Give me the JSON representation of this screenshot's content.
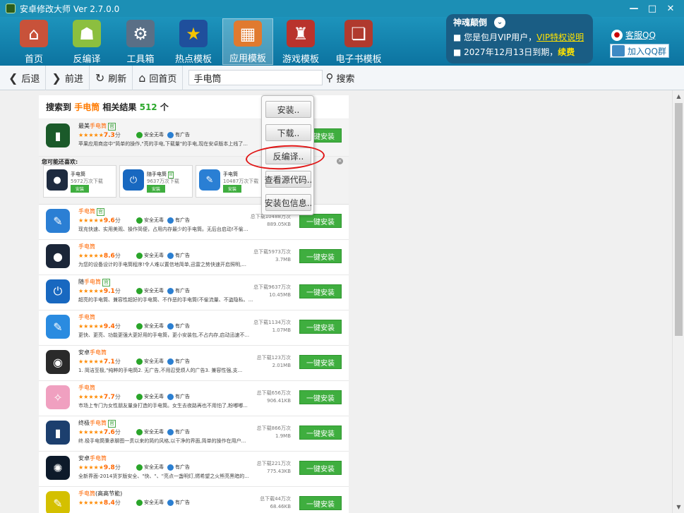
{
  "window": {
    "title": "安卓修改大师 Ver 2.7.0.0",
    "controls": {
      "minimize": "—",
      "maximize": "□",
      "close": "✕"
    }
  },
  "nav": {
    "items": [
      {
        "label": "首页",
        "icon": "house-icon",
        "color": "#c8523a",
        "glyph": "⌂"
      },
      {
        "label": "反编译",
        "icon": "android-icon",
        "color": "#8cbf3f",
        "glyph": "☗"
      },
      {
        "label": "工具箱",
        "icon": "toolbox-icon",
        "color": "#5a6f86",
        "glyph": "⚙"
      },
      {
        "label": "热点模板",
        "icon": "star-icon",
        "color": "#1f4f9c",
        "glyph": "★"
      },
      {
        "label": "应用模板",
        "icon": "app-grid-icon",
        "color": "#e07a2f",
        "glyph": "▦"
      },
      {
        "label": "游戏模板",
        "icon": "game-icon",
        "color": "#b9332c",
        "glyph": "♜"
      },
      {
        "label": "电子书模板",
        "icon": "books-icon",
        "color": "#b03a2e",
        "glyph": "❏"
      }
    ],
    "active_index": 4
  },
  "vip": {
    "title": "神魂颠倒",
    "line1_prefix": "■ 您是包月VIP用户，",
    "line1_link": "VIP特权说明",
    "line2_prefix": "■ 2027年12月13日到期，",
    "line2_link": "续费",
    "dropdown": "⌄"
  },
  "kefu": {
    "label": "客服QQ",
    "join_group": "加入QQ群"
  },
  "toolbar": {
    "back": "后退",
    "forward": "前进",
    "refresh": "刷新",
    "home": "回首页",
    "address": "手电筒",
    "search": "搜索"
  },
  "results": {
    "prefix": "搜索到",
    "keyword": "手电筒",
    "middle": "相关结果",
    "count": "512",
    "suffix": "个"
  },
  "install_label": "一键安装",
  "safe_label": "安全无毒",
  "ad_label": "有广告",
  "first_app": {
    "name_prefix": "最美",
    "name_hl": "手电筒",
    "badge": "官",
    "stars": "★★★★★",
    "score": "7.3",
    "fen": "分",
    "desc": "苹果应用商店中\"简单的操作,\"亮的手电,下载量\"的手电,现在安卓版本上线了..."
  },
  "recommend": {
    "title": "您可能还喜欢:",
    "close": "×",
    "cards": [
      {
        "name": "手电筒",
        "dl": "5972万次下载",
        "btn": "安装",
        "color": "#1e2b3f",
        "glyph": "●"
      },
      {
        "name": "随手电筒",
        "badge": "官",
        "dl": "9637万次下载",
        "btn": "安装",
        "color": "#1868c0",
        "glyph": "⏻"
      },
      {
        "name": "手电筒",
        "dl": "10487万次下载",
        "btn": "安装",
        "color": "#2a7fd4",
        "glyph": "✎"
      }
    ]
  },
  "apps": [
    {
      "name_prefix": "",
      "name_hl": "手电筒",
      "badge": "官",
      "stars": "★★★★★",
      "score": "9.6",
      "fen": "分",
      "desc": "现充快速、实用美观、操作简便，占用内存最少的手电筒。无后台启动!不偷...",
      "total": "总下载10488万次",
      "size": "889.05KB",
      "color": "#2b7fd4",
      "glyph": "✎"
    },
    {
      "name_prefix": "",
      "name_hl": "手电筒",
      "badge": "",
      "stars": "★★★★★",
      "score": "8.6",
      "fen": "分",
      "desc": "为您的设备设计的手电筒程序!令人难以置信地简单,迅雷之势快速开启照明,...",
      "total": "总下载5973万次",
      "size": "3.7MB",
      "color": "#1b2638",
      "glyph": "●"
    },
    {
      "name_prefix": "随",
      "name_hl": "手电筒",
      "badge": "官",
      "stars": "★★★★★",
      "score": "9.1",
      "fen": "分",
      "desc": "超亮的手电筒、兼容性超好的手电筒、不作恶的手电筒(不偷流量、不盗隐私、...",
      "total": "总下载9637万次",
      "size": "10.45MB",
      "color": "#1868c0",
      "glyph": "⏻"
    },
    {
      "name_prefix": "",
      "name_hl": "手电筒",
      "badge": "",
      "stars": "★★★★★",
      "score": "9.4",
      "fen": "分",
      "desc": "更快、更亮、功能更强大更好用的手电筒，更小安装包,不占内存,启动迅速不...",
      "total": "总下载1134万次",
      "size": "1.07MB",
      "color": "#2a8be0",
      "glyph": "✎"
    },
    {
      "name_prefix": "安卓",
      "name_hl": "手电筒",
      "badge": "",
      "stars": "★★★★★",
      "score": "7.1",
      "fen": "分",
      "desc": "1. 简洁至极,\"纯粹的手电筒2. 无广告,不用忍受烦人的广告3. 兼容性强,支...",
      "total": "总下载123万次",
      "size": "2.01MB",
      "color": "#2a2a2a",
      "glyph": "◉"
    },
    {
      "name_prefix": "",
      "name_hl": "手电筒",
      "badge": "",
      "stars": "★★★★★",
      "score": "7.7",
      "fen": "分",
      "desc": "市场上专门为女性朋友量身打造的手电筒。女生去夜路再也不用怕了,粉嘟嘟...",
      "total": "总下载656万次",
      "size": "906.41KB",
      "color": "#f0a0c0",
      "glyph": "✧"
    },
    {
      "name_prefix": "终极",
      "name_hl": "手电筒",
      "badge": "官",
      "stars": "★★★★★",
      "score": "7.6",
      "fen": "分",
      "desc": "终.极手电筒秉承聊图一贯以来的简约风格,以干净的界面,简单的操作在用户...",
      "total": "总下载866万次",
      "size": "1.9MB",
      "color": "#1c3f6e",
      "glyph": "▮"
    },
    {
      "name_prefix": "安卓",
      "name_hl": "手电筒",
      "badge": "",
      "stars": "★★★★★",
      "score": "9.8",
      "fen": "分",
      "desc": "全新界面-2014货岁版安全、\"快、\"、\"亮点一盏明灯,燃希望之火熊亮黑暗的...",
      "total": "总下载221万次",
      "size": "775.43KB",
      "color": "#0d1a2a",
      "glyph": "✺"
    },
    {
      "name_prefix": "",
      "name_hl": "手电筒",
      "name_suffix": "(高高节能)",
      "badge": "",
      "stars": "★★★★★",
      "score": "8.4",
      "fen": "分",
      "desc": "",
      "total": "总下载44万次",
      "size": "68.46KB",
      "color": "#d4c000",
      "glyph": "✎"
    }
  ],
  "context_menu": {
    "items": [
      "安装..",
      "下载..",
      "反编译..",
      "查看源代码..",
      "安装包信息.."
    ]
  },
  "scrollbar": {
    "up": "▲",
    "down": "▼"
  }
}
